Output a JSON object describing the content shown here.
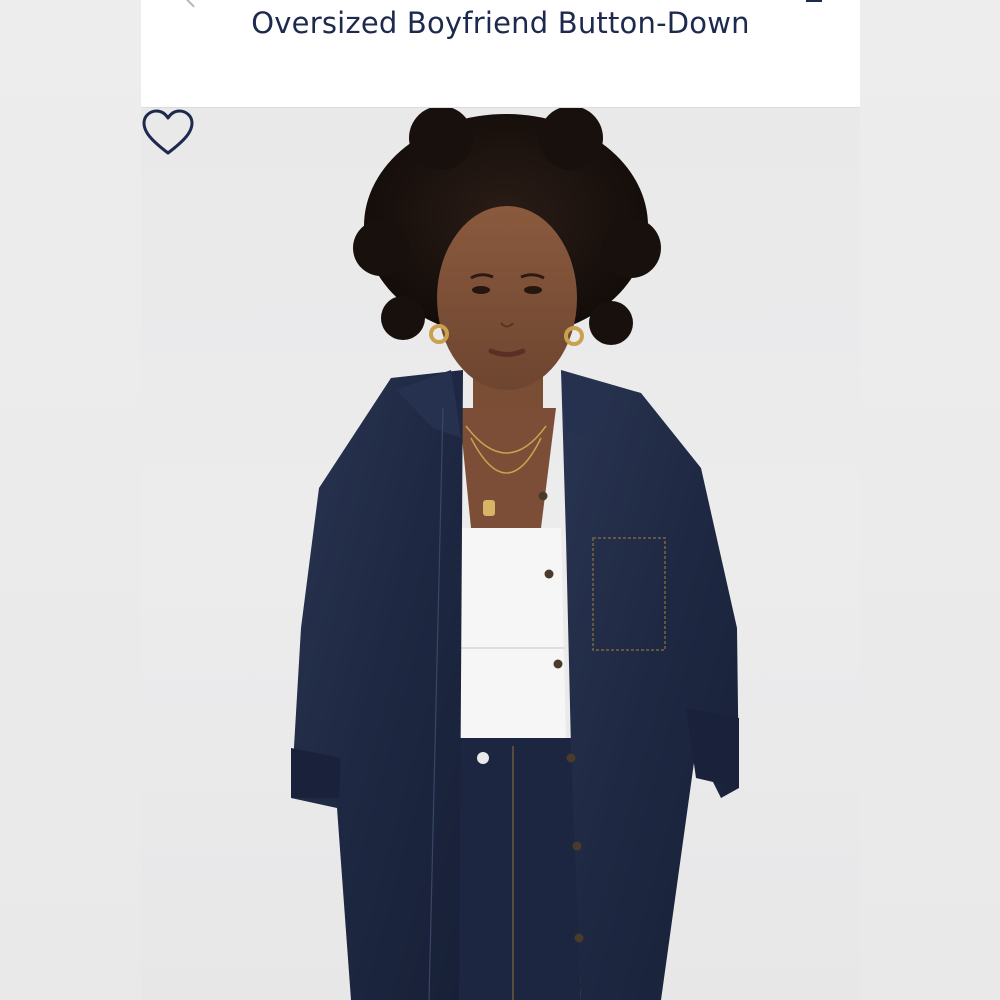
{
  "product": {
    "title": "Oversized Boyfriend Button-Down"
  },
  "icons": {
    "favorite": "heart-outline-icon",
    "back": "chevron-left-icon",
    "menu": "menu-icon"
  },
  "colors": {
    "title_text": "#1d2a4d",
    "denim": "#1f2a44",
    "background": "#ececec"
  }
}
